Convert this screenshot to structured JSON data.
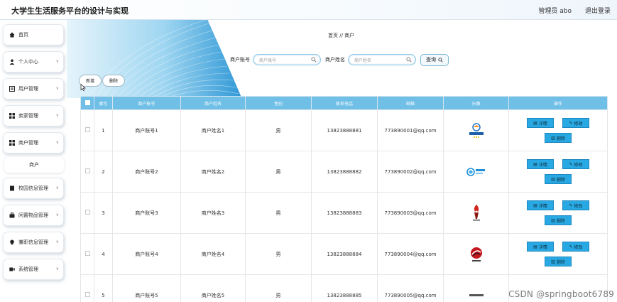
{
  "header": {
    "title": "大学生生活服务平台的设计与实现",
    "user": "管理员 abo",
    "logout": "退出登录"
  },
  "sidebar": {
    "items": [
      {
        "label": "首页",
        "icon": "home-icon"
      },
      {
        "label": "个人中心",
        "icon": "person-icon"
      },
      {
        "label": "用户管理",
        "icon": "user-manage-icon"
      },
      {
        "label": "卖家管理",
        "icon": "grid-icon"
      },
      {
        "label": "商户管理",
        "icon": "grid-icon"
      },
      {
        "label": "校园信息管理",
        "icon": "document-icon"
      },
      {
        "label": "闲置物品管理",
        "icon": "box-icon"
      },
      {
        "label": "兼职信息管理",
        "icon": "pin-icon"
      },
      {
        "label": "系统管理",
        "icon": "video-icon"
      }
    ],
    "sub_item": "商户"
  },
  "breadcrumb": "首页 // 商户",
  "search": {
    "account_label": "商户账号",
    "account_placeholder": "商户账号",
    "name_label": "商户姓名",
    "name_placeholder": "商户姓名",
    "query_label": "查询"
  },
  "actions": {
    "add": "新增",
    "delete": "删除"
  },
  "table": {
    "columns": [
      "索引",
      "商户账号",
      "商户姓名",
      "性别",
      "联系电话",
      "邮箱",
      "头像",
      "操作"
    ],
    "rows": [
      {
        "index": "1",
        "account": "商户账号1",
        "name": "商户姓名1",
        "gender": "男",
        "phone": "13823888881",
        "email": "773890001@qq.com",
        "avatar": "seafood-logo"
      },
      {
        "index": "2",
        "account": "商户账号2",
        "name": "商户姓名2",
        "gender": "男",
        "phone": "13823888882",
        "email": "773890002@qq.com",
        "avatar": "china-mobile-logo"
      },
      {
        "index": "3",
        "account": "商户账号3",
        "name": "商户姓名3",
        "gender": "男",
        "phone": "13823888883",
        "email": "773890003@qq.com",
        "avatar": "torch-logo"
      },
      {
        "index": "4",
        "account": "商户账号4",
        "name": "商户姓名4",
        "gender": "男",
        "phone": "13823888884",
        "email": "773890004@qq.com",
        "avatar": "red-emblem-logo"
      },
      {
        "index": "5",
        "account": "商户账号5",
        "name": "商户姓名5",
        "gender": "男",
        "phone": "13823888885",
        "email": "773890005@qq.com",
        "avatar": "partial-logo"
      }
    ],
    "ops": {
      "detail": "详情",
      "edit": "修改",
      "remove": "删除"
    }
  },
  "colors": {
    "header_bg": "#6fbfe7",
    "op_button": "#29a9e3",
    "banner": "#3aa3df"
  },
  "watermark": "CSDN @springboot6789"
}
